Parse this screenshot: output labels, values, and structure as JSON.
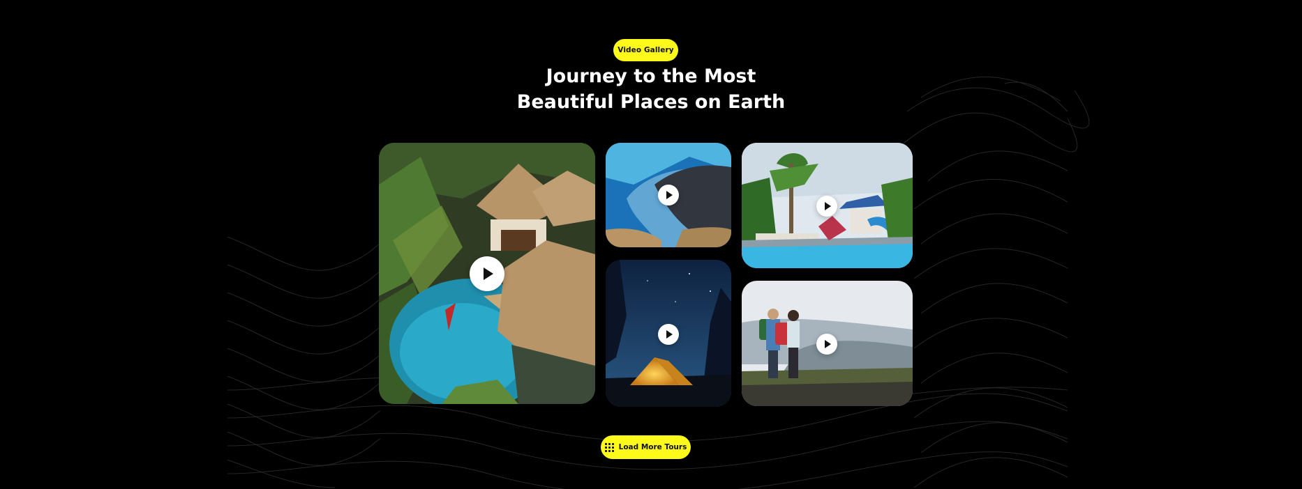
{
  "section": {
    "badge_label": "Video Gallery",
    "title_line1": "Journey to the Most",
    "title_line2": "Beautiful Places on Earth"
  },
  "gallery": {
    "videos": [
      {
        "scene": "tropical-villa-pool",
        "play_icon": "play-icon"
      },
      {
        "scene": "blue-ocean-coast",
        "play_icon": "play-icon"
      },
      {
        "scene": "resort-waterslide-pool",
        "play_icon": "play-icon"
      },
      {
        "scene": "night-tent-camping",
        "play_icon": "play-icon"
      },
      {
        "scene": "hikers-on-cliff",
        "play_icon": "play-icon"
      }
    ]
  },
  "actions": {
    "load_more_label": "Load More Tours",
    "load_more_icon": "grid-icon"
  },
  "colors": {
    "background": "#000000",
    "accent": "#fdf91a",
    "text": "#ffffff",
    "wave_lines": "#2a2a2a"
  }
}
